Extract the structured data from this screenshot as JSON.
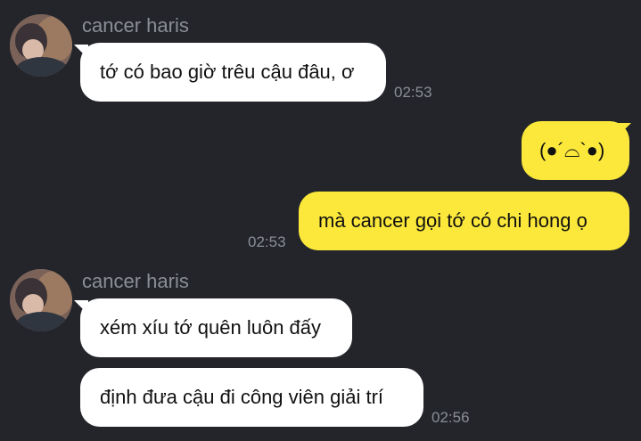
{
  "chat": {
    "messages": [
      {
        "sender": "cancer haris",
        "text": "tớ có bao giờ trêu cậu đâu, ơ",
        "time": "02:53"
      },
      {
        "text": "(●´⌓`●)"
      },
      {
        "text": "mà cancer gọi tớ có chi hong ọ",
        "time": "02:53"
      },
      {
        "sender": "cancer haris",
        "text": "xém xíu tớ quên luôn đấy"
      },
      {
        "text": "định đưa cậu đi công viên giải trí",
        "time": "02:56"
      }
    ]
  },
  "colors": {
    "background": "#23252b",
    "incoming_bubble": "#ffffff",
    "outgoing_bubble": "#fce83a",
    "meta_text": "#8b8e96"
  }
}
